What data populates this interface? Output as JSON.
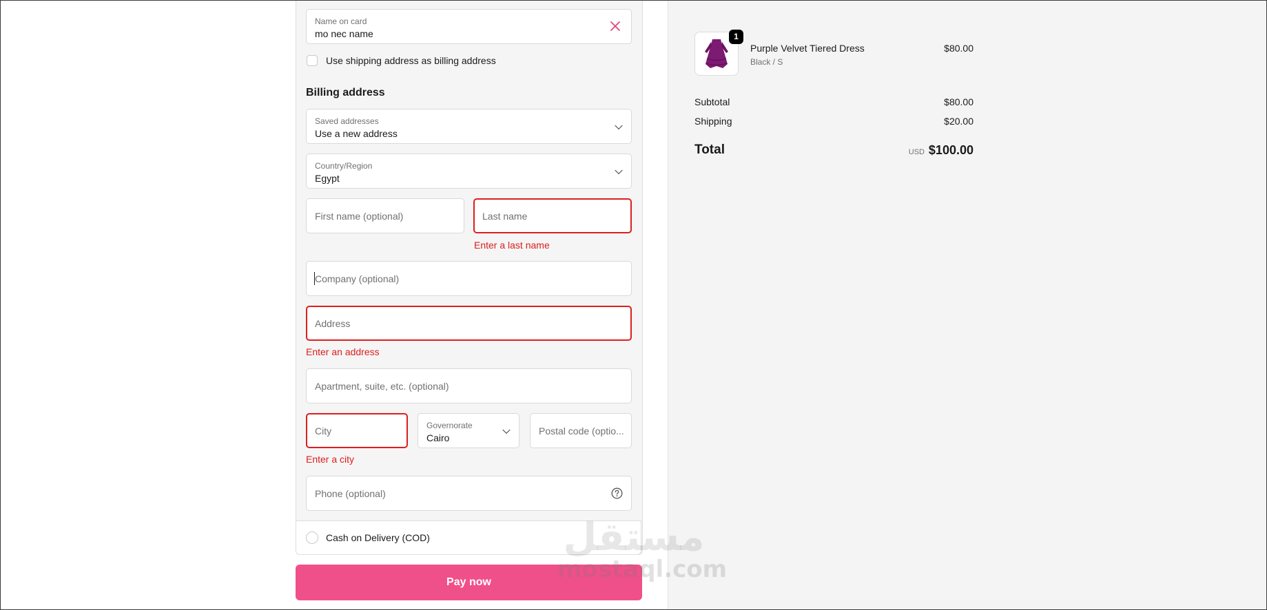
{
  "form": {
    "name_on_card": {
      "label": "Name on card",
      "value": "mo nec name"
    },
    "shipping_as_billing_label": "Use shipping address as billing address",
    "billing_heading": "Billing address",
    "saved_addresses": {
      "label": "Saved addresses",
      "value": "Use a new address"
    },
    "country": {
      "label": "Country/Region",
      "value": "Egypt"
    },
    "first_name_placeholder": "First name (optional)",
    "last_name_placeholder": "Last name",
    "last_name_error": "Enter a last name",
    "company_placeholder": "Company (optional)",
    "address_placeholder": "Address",
    "address_error": "Enter an address",
    "apartment_placeholder": "Apartment, suite, etc. (optional)",
    "city_placeholder": "City",
    "city_error": "Enter a city",
    "governorate": {
      "label": "Governorate",
      "value": "Cairo"
    },
    "postal_placeholder": "Postal code (optio...",
    "phone_placeholder": "Phone (optional)",
    "cod_label": "Cash on Delivery (COD)",
    "pay_button": "Pay now"
  },
  "summary": {
    "item": {
      "name": "Purple Velvet Tiered Dress",
      "variant": "Black / S",
      "price": "$80.00",
      "quantity": "1"
    },
    "subtotal_label": "Subtotal",
    "subtotal_value": "$80.00",
    "shipping_label": "Shipping",
    "shipping_value": "$20.00",
    "total_label": "Total",
    "currency": "USD",
    "total_value": "$100.00"
  },
  "watermark": {
    "arabic": "مستقل",
    "latin": "mostaql.com"
  },
  "colors": {
    "accent": "#f0508a",
    "error": "#dd1d1d",
    "dress": "#7d1a73"
  }
}
